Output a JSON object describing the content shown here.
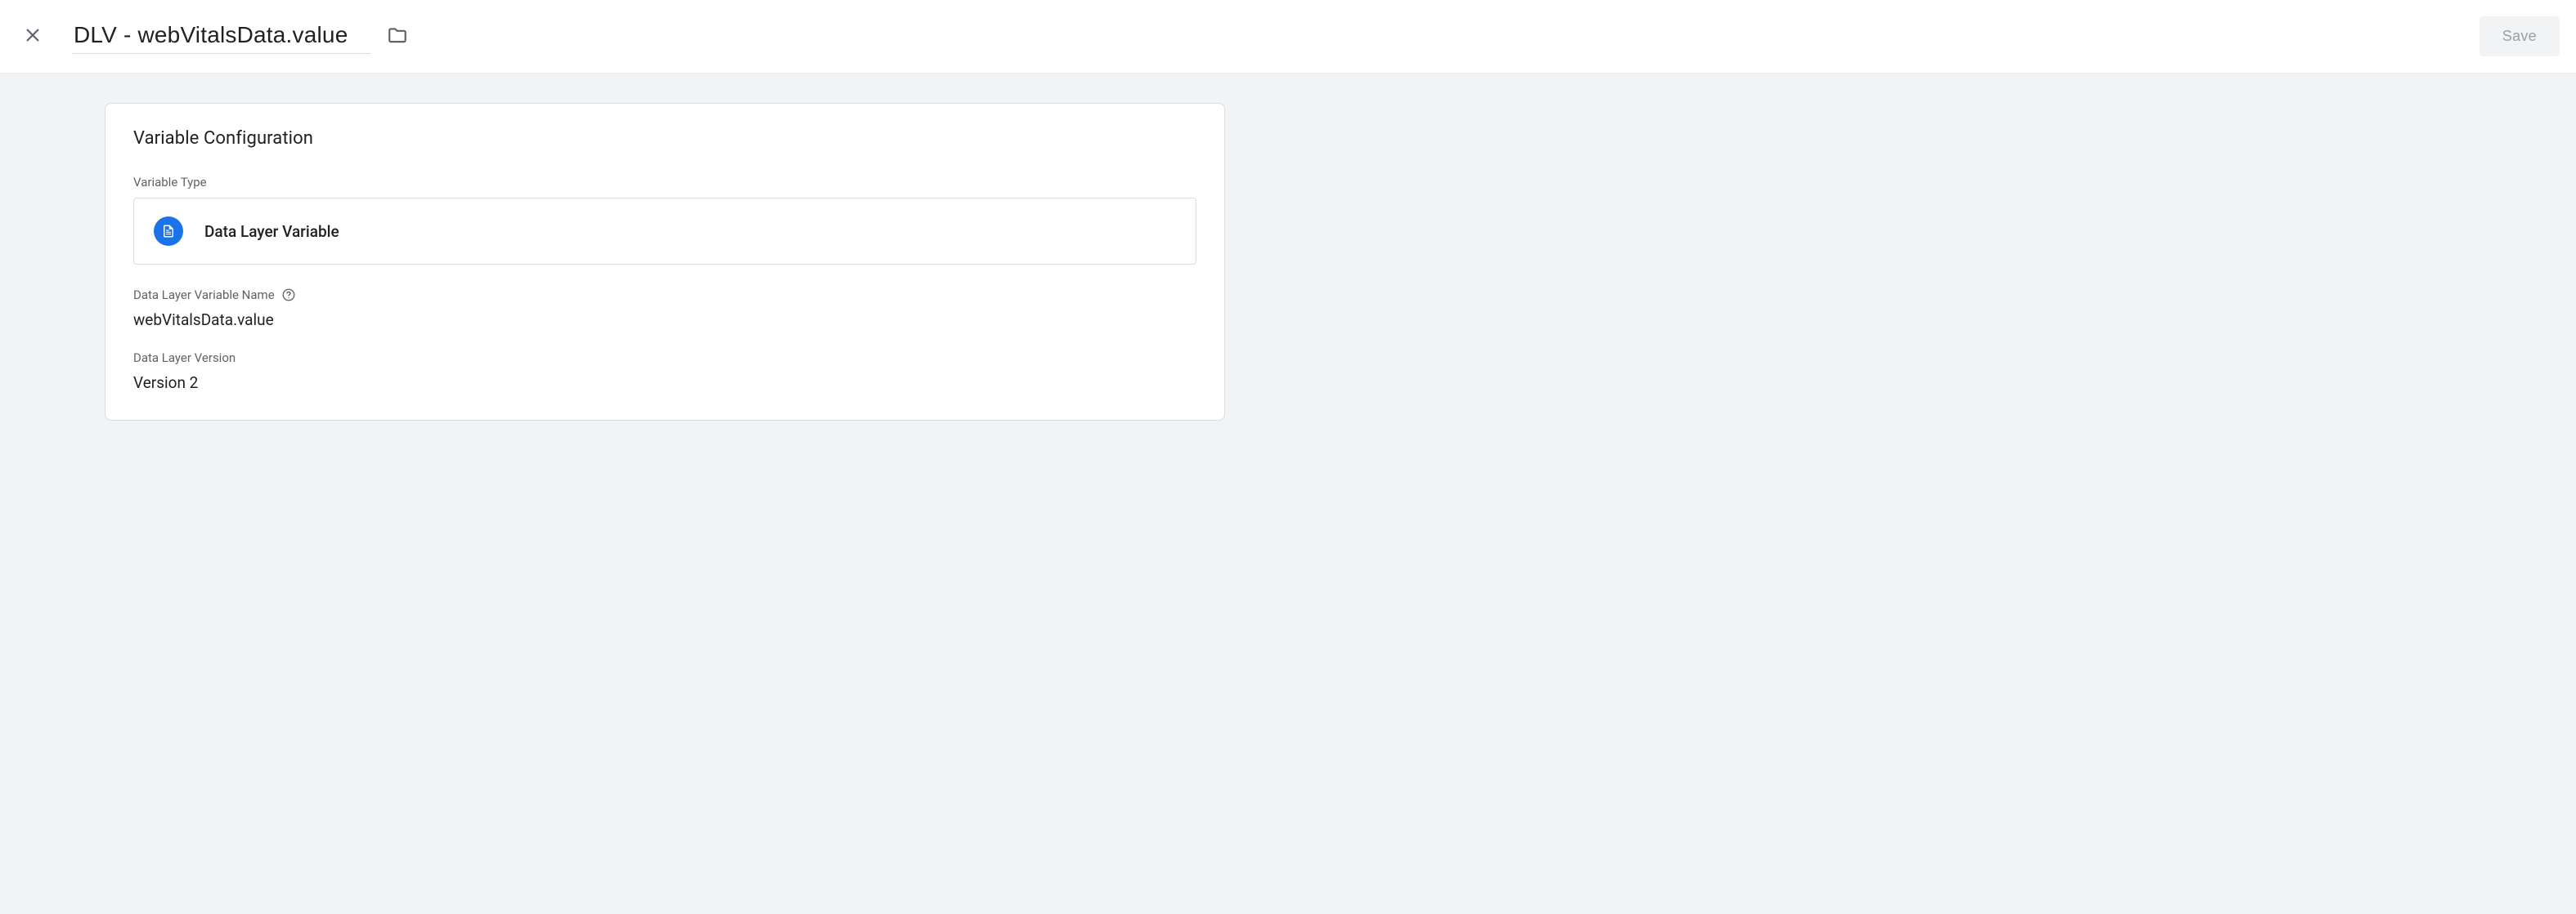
{
  "header": {
    "title": "DLV - webVitalsData.value",
    "save_label": "Save"
  },
  "card": {
    "title": "Variable Configuration",
    "variable_type_label": "Variable Type",
    "variable_type_value": "Data Layer Variable",
    "dlv_name_label": "Data Layer Variable Name",
    "dlv_name_value": "webVitalsData.value",
    "dlv_version_label": "Data Layer Version",
    "dlv_version_value": "Version 2"
  }
}
